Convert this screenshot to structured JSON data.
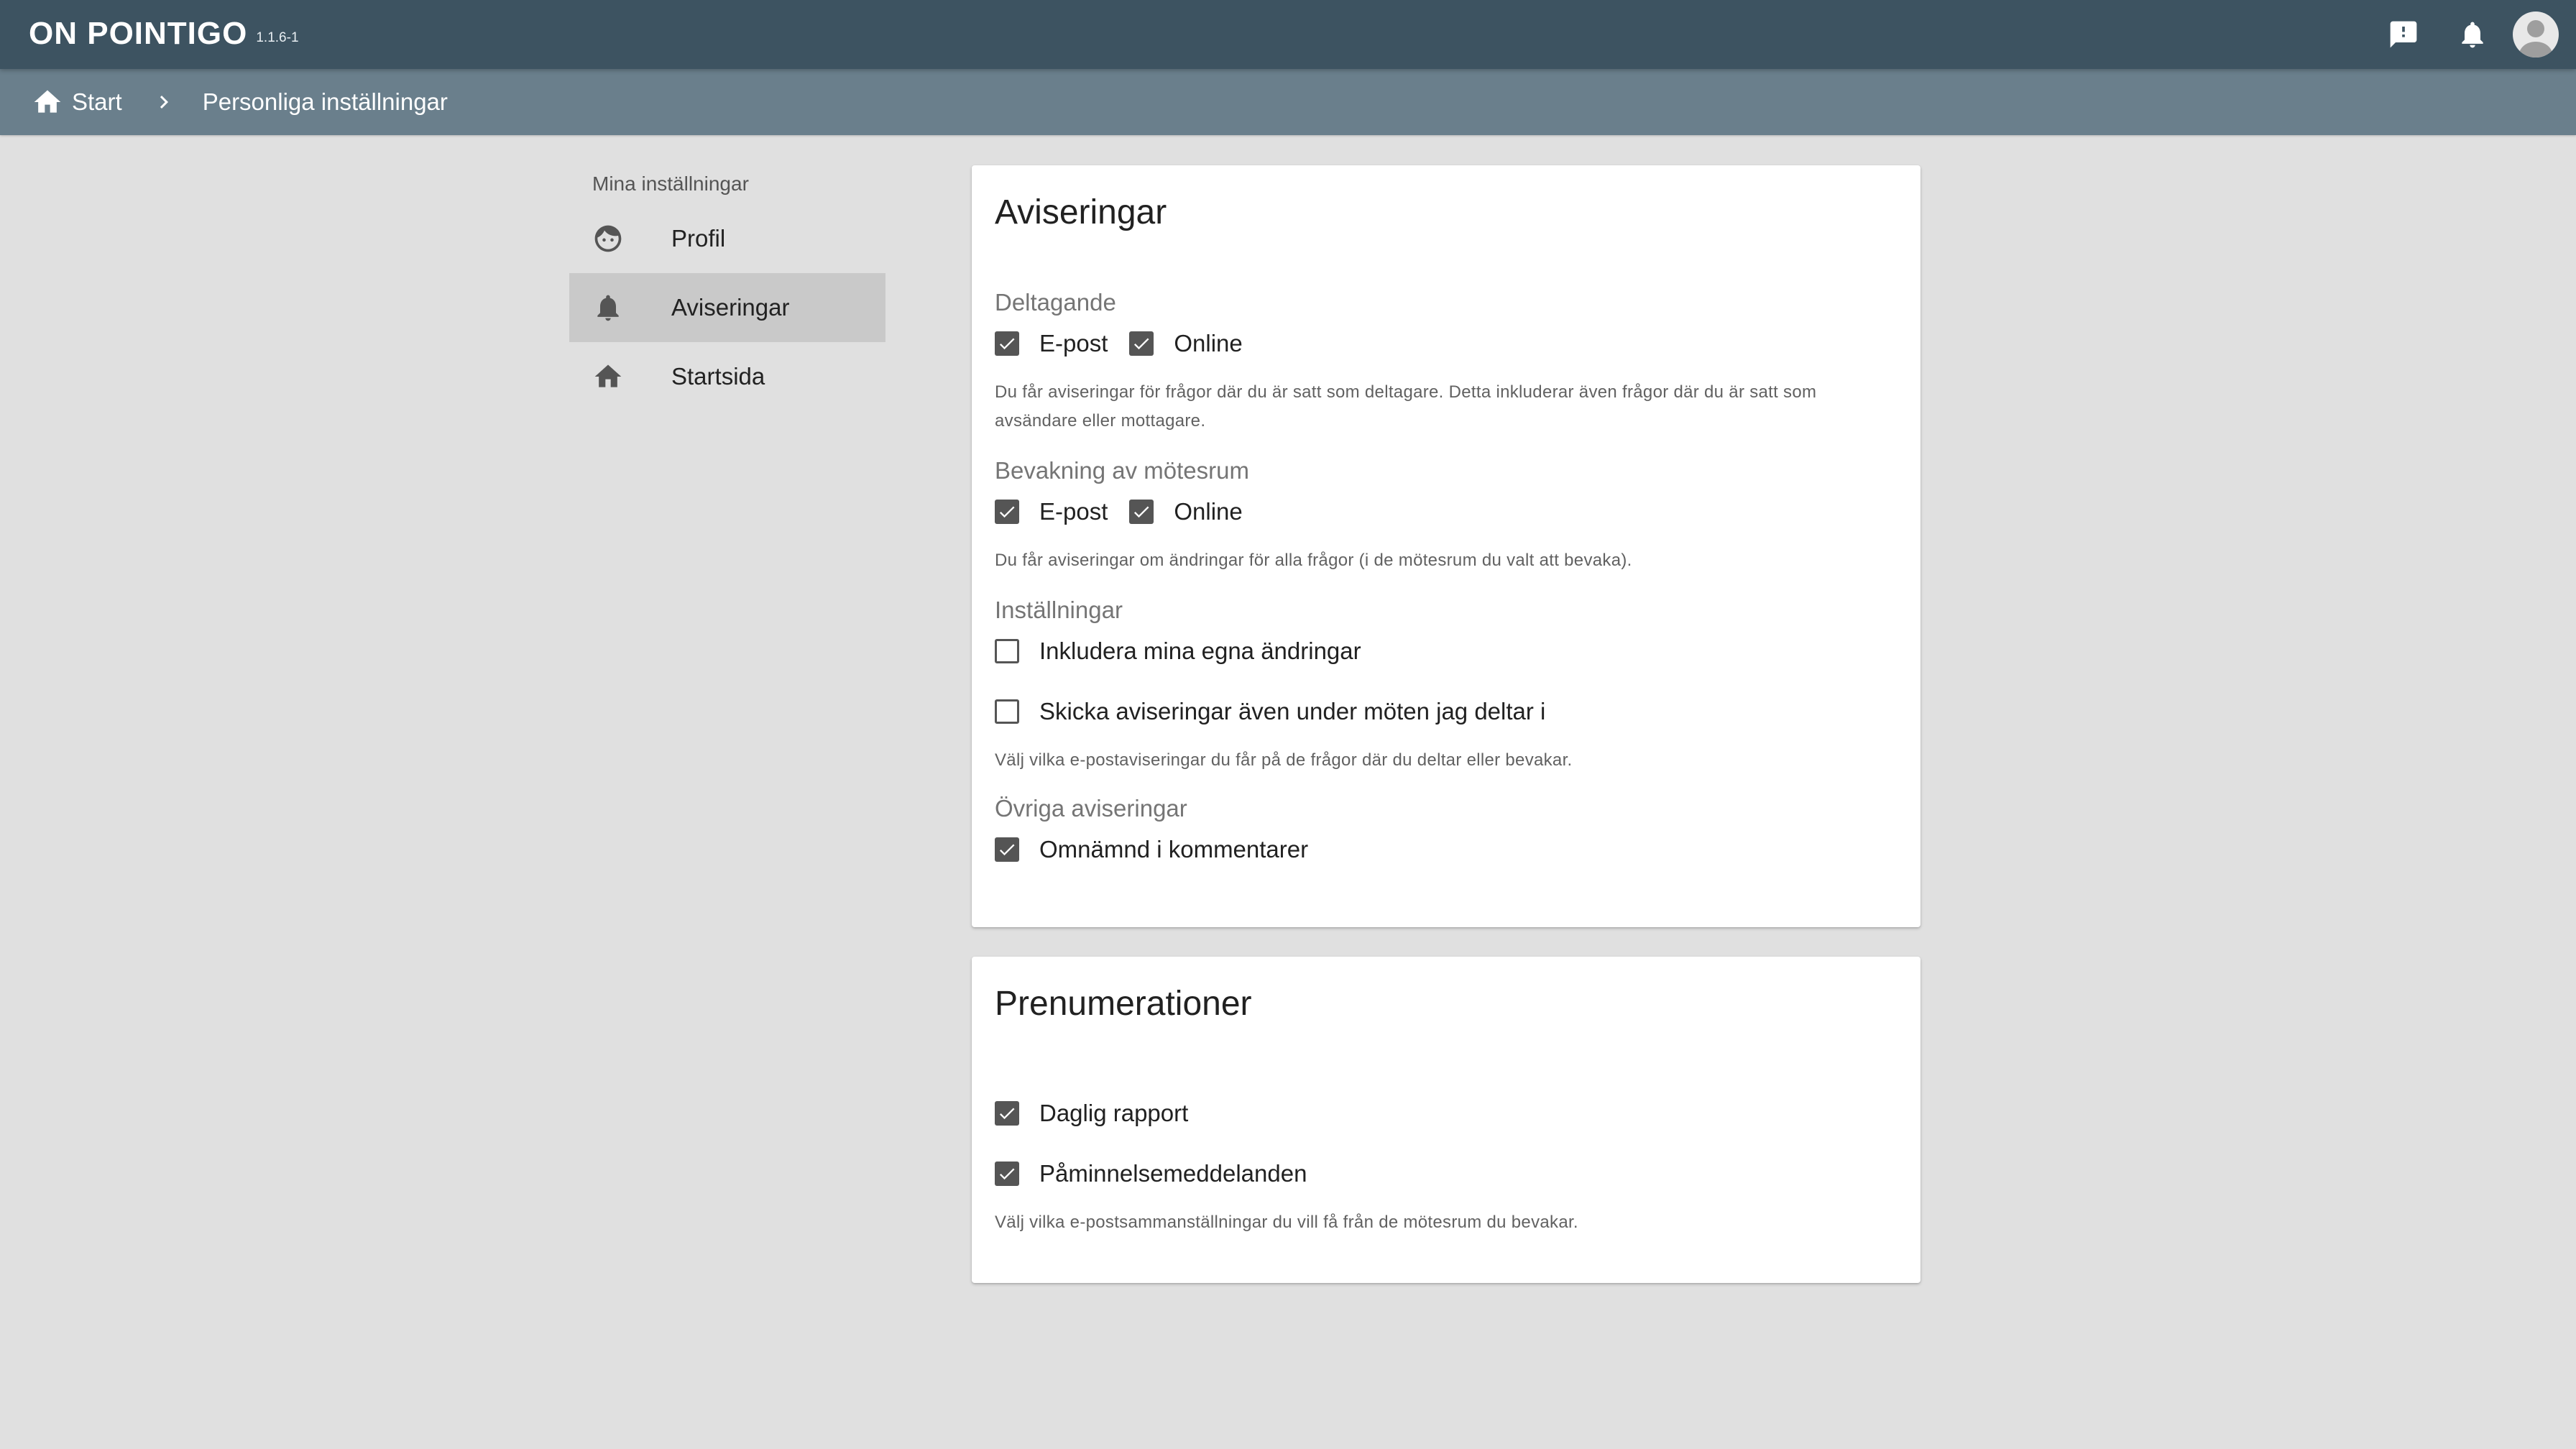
{
  "app": {
    "logo": "ON POINTIGO",
    "version": "1.1.6-1"
  },
  "topbar": {
    "feedback_icon": "feedback-icon",
    "bell_icon": "bell-icon",
    "avatar_icon": "account-avatar-icon"
  },
  "breadcrumb": {
    "home": "Start",
    "current": "Personliga inställningar"
  },
  "sidebar": {
    "title": "Mina inställningar",
    "items": [
      {
        "label": "Profil",
        "icon": "face-icon",
        "active": false
      },
      {
        "label": "Aviseringar",
        "icon": "bell-icon",
        "active": true
      },
      {
        "label": "Startsida",
        "icon": "home-icon",
        "active": false
      }
    ]
  },
  "notifications": {
    "title": "Aviseringar",
    "participation": {
      "label": "Deltagande",
      "email": {
        "label": "E-post",
        "checked": true
      },
      "online": {
        "label": "Online",
        "checked": true
      },
      "hint": "Du får aviseringar för frågor där du är satt som deltagare. Detta inkluderar även frågor där du är satt som avsändare eller mottagare."
    },
    "room_watch": {
      "label": "Bevakning av mötesrum",
      "email": {
        "label": "E-post",
        "checked": true
      },
      "online": {
        "label": "Online",
        "checked": true
      },
      "hint": "Du får aviseringar om ändringar för alla frågor (i de mötesrum du valt att bevaka)."
    },
    "settings": {
      "label": "Inställningar",
      "include_own": {
        "label": "Inkludera mina egna ändringar",
        "checked": false
      },
      "during_meetings": {
        "label": "Skicka aviseringar även under möten jag deltar i",
        "checked": false
      },
      "hint": "Välj vilka e-postaviseringar du får på de frågor där du deltar eller bevakar."
    },
    "other": {
      "label": "Övriga aviseringar",
      "mentioned": {
        "label": "Omnämnd i kommentarer",
        "checked": true
      }
    }
  },
  "subscriptions": {
    "title": "Prenumerationer",
    "daily": {
      "label": "Daglig rapport",
      "checked": true
    },
    "reminders": {
      "label": "Påminnelsemeddelanden",
      "checked": true
    },
    "hint": "Välj vilka e-postsammanställningar du vill få från de mötesrum du bevakar."
  },
  "colors": {
    "topbar": "#3d5361",
    "breadcrumb": "#6a7f8c",
    "background": "#e0e0e0",
    "checkbox": "#555555"
  }
}
